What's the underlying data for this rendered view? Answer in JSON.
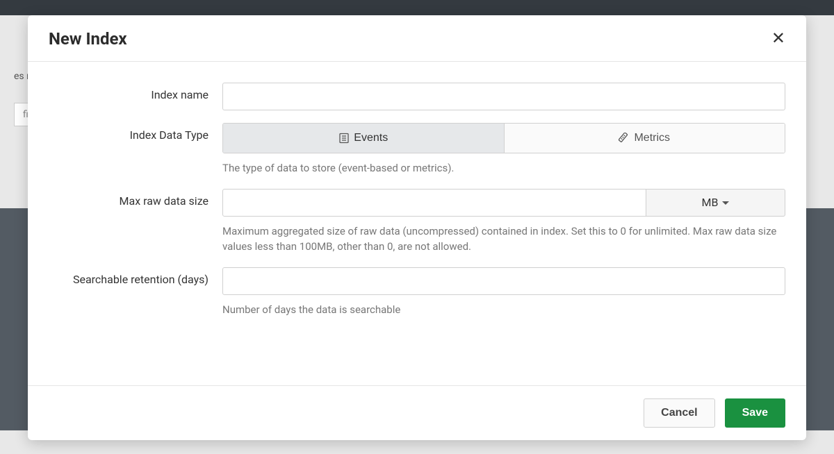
{
  "background": {
    "partial_text": "es res",
    "filter_placeholder": "fil"
  },
  "modal": {
    "title": "New Index",
    "fields": {
      "index_name": {
        "label": "Index name",
        "value": ""
      },
      "data_type": {
        "label": "Index Data Type",
        "options": {
          "events": "Events",
          "metrics": "Metrics"
        },
        "selected": "events",
        "help": "The type of data to store (event-based or metrics)."
      },
      "max_size": {
        "label": "Max raw data size",
        "value": "",
        "unit": "MB",
        "help": "Maximum aggregated size of raw data (uncompressed) contained in index. Set this to 0 for unlimited. Max raw data size values less than 100MB, other than 0, are not allowed."
      },
      "retention": {
        "label": "Searchable retention (days)",
        "value": "",
        "help": "Number of days the data is searchable"
      }
    },
    "buttons": {
      "cancel": "Cancel",
      "save": "Save"
    }
  }
}
